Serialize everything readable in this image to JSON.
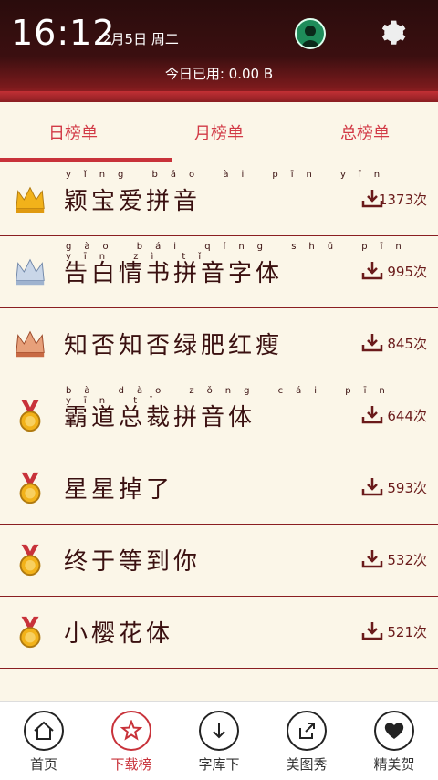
{
  "status": {
    "time": "16:12",
    "date": "2月5日  周二"
  },
  "header": {
    "usage_text": "今日已用: 0.00 B"
  },
  "tabs": [
    "日榜单",
    "月榜单",
    "总榜单"
  ],
  "rows": [
    {
      "badge": "gold-crown",
      "name": "颖宝爱拼音",
      "pinyin": "yǐng bǎo ài pīn yīn",
      "count": "1373次"
    },
    {
      "badge": "silver-crown",
      "name": "告白情书拼音字体",
      "pinyin": "gào bái qíng shū pīn yīn zì tǐ",
      "count": "995次"
    },
    {
      "badge": "bronze-crown",
      "name": "知否知否绿肥红瘦",
      "pinyin": "",
      "count": "845次"
    },
    {
      "badge": "medal",
      "name": "霸道总裁拼音体",
      "pinyin": "bà dào zǒng cái pīn yīn tǐ",
      "count": "644次"
    },
    {
      "badge": "medal",
      "name": "星星掉了",
      "pinyin": "",
      "count": "593次"
    },
    {
      "badge": "medal",
      "name": "终于等到你",
      "pinyin": "",
      "count": "532次"
    },
    {
      "badge": "medal",
      "name": "小樱花体",
      "pinyin": "",
      "count": "521次"
    }
  ],
  "bottom_nav": [
    {
      "label": "首页",
      "icon": "home-icon"
    },
    {
      "label": "下载榜",
      "icon": "star-icon"
    },
    {
      "label": "字库下",
      "icon": "download-icon"
    },
    {
      "label": "美图秀",
      "icon": "share-icon"
    },
    {
      "label": "精美贺",
      "icon": "heart-icon"
    }
  ]
}
